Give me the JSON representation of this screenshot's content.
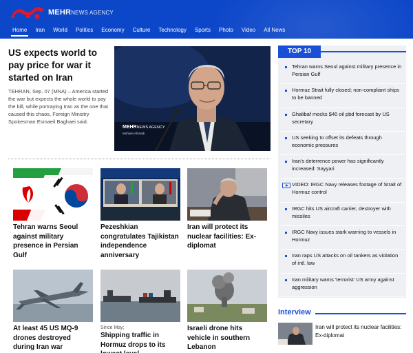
{
  "brand": {
    "name": "MEHR",
    "suffix": "NEWS AGENCY",
    "accent": "#0d47c9",
    "logo_red": "#e0182d"
  },
  "nav": {
    "items": [
      {
        "label": "Home",
        "active": true
      },
      {
        "label": "Iran"
      },
      {
        "label": "World"
      },
      {
        "label": "Politics"
      },
      {
        "label": "Economy"
      },
      {
        "label": "Culture"
      },
      {
        "label": "Technology"
      },
      {
        "label": "Sports"
      },
      {
        "label": "Photo"
      },
      {
        "label": "Video"
      },
      {
        "label": "All News"
      }
    ]
  },
  "lead": {
    "title": "US expects world to pay price for war it started on Iran",
    "summary": "TEHRAN, Sep. 07 (MNA) – America started the war but expects the whole world to pay the bill, while portraying Iran as the one that caused this chaos, Foreign Ministry Spokesman Esmaeil Baghaei said.",
    "photo_watermark": {
      "name": "MEHR",
      "suffix": "NEWS AGENCY",
      "credit": "Mohsen Ahmadi"
    }
  },
  "grid": [
    {
      "title": "Tehran warns Seoul against military presence in Persian Gulf"
    },
    {
      "title": "Pezeshkian congratulates Tajikistan independence anniversary"
    },
    {
      "title": "Iran will protect its nuclear facilities: Ex-diplomat"
    },
    {
      "title": "At least 45 US MQ-9 drones destroyed during Iran war"
    },
    {
      "tag": "Since May;",
      "title": "Shipping traffic in Hormuz drops to its lowest level"
    },
    {
      "title": "Israeli drone hits vehicle in southern Lebanon"
    }
  ],
  "top10": {
    "heading": "TOP 10",
    "items": [
      {
        "text": "Tehran warns Seoul against military presence in Persian Gulf"
      },
      {
        "text": "Hormuz Strait fully closed; non-compliant ships to be banned"
      },
      {
        "text": "Ghalibaf mocks $40 oil pbd forecast by US secretary"
      },
      {
        "text": "US seeking to offset its defeats through economic pressures"
      },
      {
        "text": "Iran's deterrence power has significantly increased: Sayyari"
      },
      {
        "text": "VIDEO: IRGC Navy releases footage of Strait of Hormuz control",
        "video": true
      },
      {
        "text": "IRGC hits US aircraft carrier, destroyer with missiles"
      },
      {
        "text": "IRGC Navy issues stark warning to vessels in Hormuz"
      },
      {
        "text": "Iran raps US attacks on oil tankers as violation of intl. law"
      },
      {
        "text": "Iran military warns 'terrorist' US army against aggression"
      }
    ]
  },
  "interview": {
    "heading": "Interview",
    "item": {
      "title": "Iran will protect its nuclear facilities: Ex-diplomat"
    }
  }
}
